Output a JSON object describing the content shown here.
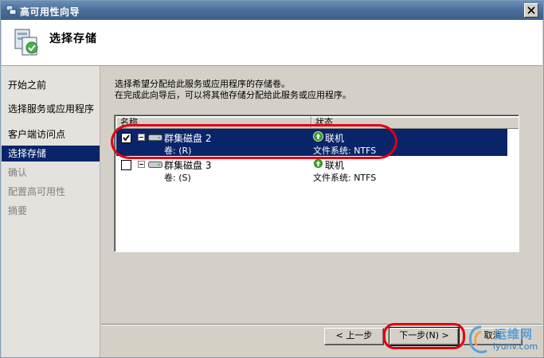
{
  "window": {
    "title": "高可用性向导"
  },
  "header": {
    "title": "选择存储"
  },
  "nav": {
    "items": [
      {
        "label": "开始之前",
        "state": "done"
      },
      {
        "label": "选择服务或应用程序",
        "state": "done"
      },
      {
        "label": "客户端访问点",
        "state": "done"
      },
      {
        "label": "选择存储",
        "state": "current"
      },
      {
        "label": "确认",
        "state": "pending"
      },
      {
        "label": "配置高可用性",
        "state": "pending"
      },
      {
        "label": "摘要",
        "state": "pending"
      }
    ]
  },
  "main": {
    "description_line1": "选择希望分配给此服务或应用程序的存储卷。",
    "description_line2": "在完成此向导后，可以将其他存储分配给此服务或应用程序。",
    "columns": {
      "name": "名称",
      "status": "状态"
    },
    "disks": [
      {
        "name": "群集磁盘 2",
        "volume": "卷: (R)",
        "status": "联机",
        "filesystem": "文件系统: NTFS",
        "checked": true,
        "selected": true
      },
      {
        "name": "群集磁盘 3",
        "volume": "卷: (S)",
        "status": "联机",
        "filesystem": "文件系统: NTFS",
        "checked": false,
        "selected": false
      }
    ]
  },
  "buttons": {
    "prev": "< 上一步",
    "next": "下一步(N) >",
    "cancel": "取消"
  },
  "watermark": {
    "text": "运维网",
    "url": "iyunv.com"
  },
  "colors": {
    "titlebar": "#4a6e97",
    "selection": "#0a246a",
    "annotation": "#e00010",
    "status_ok": "#3c9a2a"
  }
}
